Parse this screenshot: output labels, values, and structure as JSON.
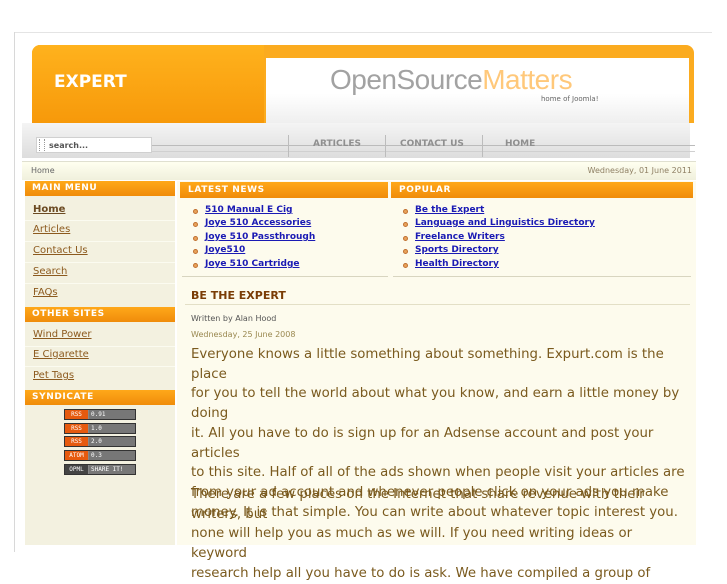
{
  "header": {
    "brand": "EXPERT",
    "logo_part1": "OpenSource",
    "logo_part2": "Matters",
    "tagline": "home of Joomla!"
  },
  "search": {
    "value": "search..."
  },
  "nav": {
    "items": [
      {
        "label": "ARTICLES"
      },
      {
        "label": "CONTACT US"
      },
      {
        "label": "HOME"
      }
    ]
  },
  "breadcrumb": "Home",
  "date": "Wednesday, 01 June 2011",
  "sidebar": {
    "main_menu_title": "MAIN MENU",
    "main_menu": [
      "Home",
      "Articles",
      "Contact Us",
      "Search",
      "FAQs"
    ],
    "other_sites_title": "OTHER SITES",
    "other_sites": [
      "Wind Power",
      "E Cigarette",
      "Pet Tags"
    ],
    "syndicate_title": "SYNDICATE",
    "feeds": [
      {
        "type": "RSS",
        "version": "0.91"
      },
      {
        "type": "RSS",
        "version": "1.0"
      },
      {
        "type": "RSS",
        "version": "2.0"
      },
      {
        "type": "ATOM",
        "version": "0.3"
      },
      {
        "type": "OPML",
        "version": "SHARE IT!"
      }
    ]
  },
  "latest_news": {
    "title": "LATEST NEWS",
    "items": [
      "510 Manual E Cig",
      "Joye 510 Accessories",
      "Joye 510 Passthrough",
      "Joye510",
      "Joye 510 Cartridge"
    ]
  },
  "popular": {
    "title": "POPULAR",
    "items": [
      "Be the Expert",
      "Language and Linguistics Directory",
      "Freelance Writers",
      "Sports Directory",
      "Health Directory"
    ]
  },
  "article": {
    "title": "BE THE EXPERT",
    "author": "Written by Alan Hood",
    "date": "Wednesday, 25 June 2008",
    "para1_lines": [
      "Everyone knows a little something about something.  Expurt.com is the place",
      "for you to tell the world about what you know, and earn a little money by doing",
      "it.  All you have to do is sign up for an Adsense account and post your articles",
      "to this site.  Half of all of the ads shown when people visit your articles are",
      "from your ad account and whenever people click on your ads you make",
      "money.  It is that simple.  You can write about whatever topic interest you."
    ],
    "para2_lines": [
      "There are a few places on the Internet that share revenue with their writers, but",
      "none will help you as much as we will.  If you need writing ideas or keyword",
      "research help all you have to do is ask.  We have compiled a group of"
    ]
  }
}
